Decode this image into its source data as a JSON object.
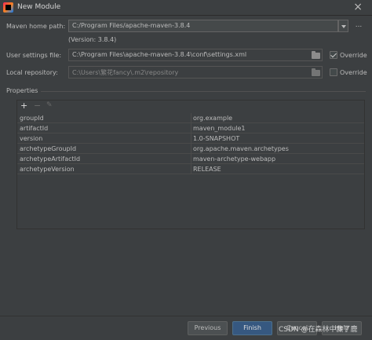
{
  "window": {
    "title": "New Module"
  },
  "maven_home": {
    "label": "Maven home path:",
    "value": "C:/Program Files/apache-maven-3.8.4",
    "version": "(Version: 3.8.4)",
    "more_label": "..."
  },
  "user_settings": {
    "label": "User settings file:",
    "value": "C:\\Program Files\\apache-maven-3.8.4\\conf\\settings.xml",
    "override_label": "Override",
    "override_checked": true
  },
  "local_repo": {
    "label": "Local repository:",
    "value": "C:\\Users\\繁花fancy\\.m2\\repository",
    "override_label": "Override",
    "override_checked": false
  },
  "properties": {
    "title": "Properties",
    "toolbar": {
      "add": "+",
      "remove": "−",
      "edit": "✎"
    },
    "rows": [
      {
        "key": "groupId",
        "value": "org.example"
      },
      {
        "key": "artifactId",
        "value": "maven_module1"
      },
      {
        "key": "version",
        "value": "1.0-SNAPSHOT"
      },
      {
        "key": "archetypeGroupId",
        "value": "org.apache.maven.archetypes"
      },
      {
        "key": "archetypeArtifactId",
        "value": "maven-archetype-webapp"
      },
      {
        "key": "archetypeVersion",
        "value": "RELEASE"
      }
    ]
  },
  "buttons": {
    "previous": "Previous",
    "finish": "Finish",
    "cancel": "Cancel",
    "help": "Help"
  },
  "watermark": "CSDN @在森林中麋了鹿"
}
